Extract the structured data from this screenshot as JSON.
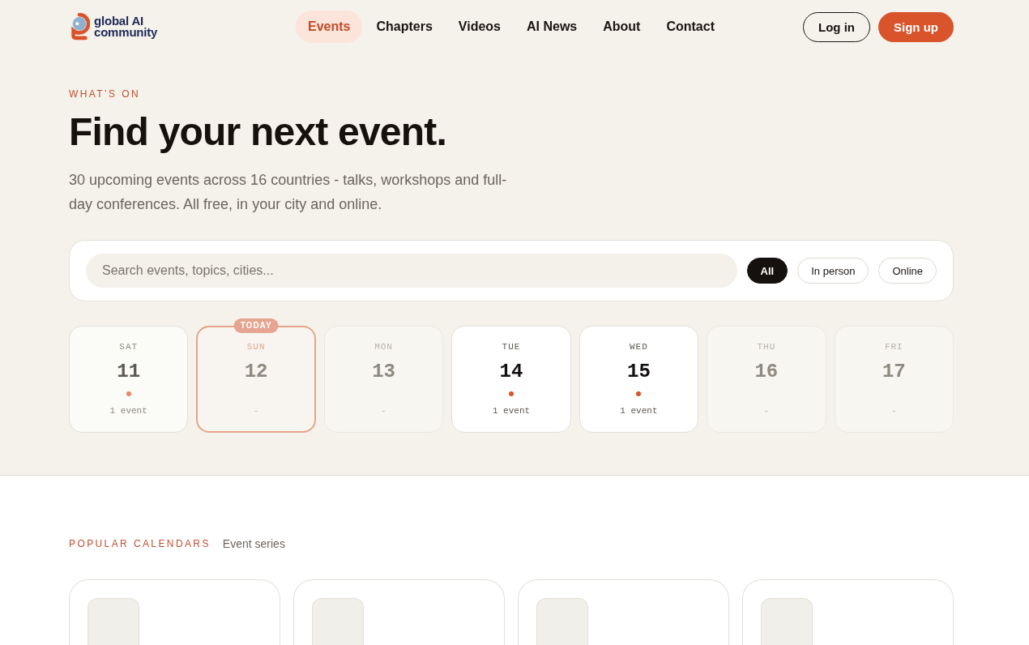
{
  "header": {
    "logo": {
      "line_1": "global AI",
      "line_2": "community"
    },
    "nav": [
      {
        "label": "Events",
        "selected": true
      },
      {
        "label": "Chapters",
        "selected": false
      },
      {
        "label": "Videos",
        "selected": false
      },
      {
        "label": "AI News",
        "selected": false
      },
      {
        "label": "About",
        "selected": false
      },
      {
        "label": "Contact",
        "selected": false
      }
    ],
    "actions": [
      {
        "label": "Log in",
        "kind": "outline"
      },
      {
        "label": "Sign up",
        "kind": "primary"
      }
    ]
  },
  "hero": {
    "eyebrow": "WHAT’S ON",
    "title": "Find your next event.",
    "intro": "30 upcoming events across 16 countries - talks, workshops and full-day conferences. All free, in your city and online."
  },
  "search": {
    "placeholder": "Search events, topics, cities...",
    "filters": [
      {
        "label": "All",
        "selected": true
      },
      {
        "label": "In person",
        "selected": false
      },
      {
        "label": "Online",
        "selected": false
      }
    ]
  },
  "days": [
    {
      "weekday": "SAT",
      "day": "11",
      "count": "1 event",
      "has_events": true,
      "past": true,
      "today": false
    },
    {
      "weekday": "SUN",
      "day": "12",
      "count": "-",
      "has_events": false,
      "past": false,
      "today": true,
      "badge": "TODAY"
    },
    {
      "weekday": "MON",
      "day": "13",
      "count": "-",
      "has_events": false,
      "past": false,
      "today": false
    },
    {
      "weekday": "TUE",
      "day": "14",
      "count": "1 event",
      "has_events": true,
      "past": false,
      "today": false
    },
    {
      "weekday": "WED",
      "day": "15",
      "count": "1 event",
      "has_events": true,
      "past": false,
      "today": false
    },
    {
      "weekday": "THU",
      "day": "16",
      "count": "-",
      "has_events": false,
      "past": false,
      "today": false
    },
    {
      "weekday": "FRI",
      "day": "17",
      "count": "-",
      "has_events": false,
      "past": false,
      "today": false
    }
  ],
  "calendars": {
    "title": "POPULAR CALENDARS",
    "subtitle": "Event series",
    "items": [
      {
        "kind": "thumbnail"
      },
      {
        "kind": "thumbnail"
      },
      {
        "kind": "thumbnail"
      },
      {
        "kind": "thumbnail"
      }
    ]
  }
}
